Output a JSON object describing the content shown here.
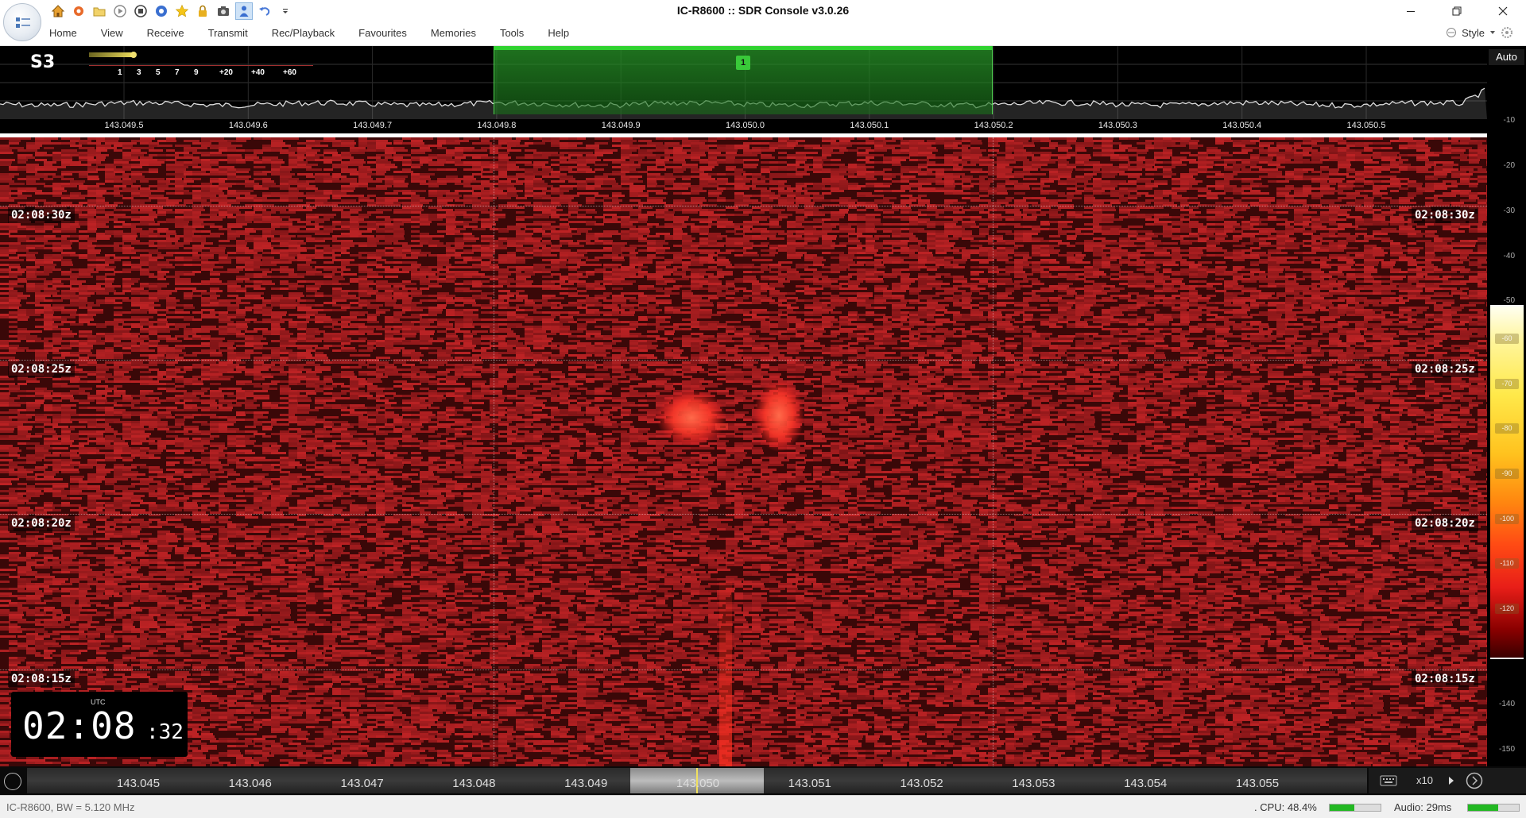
{
  "window": {
    "title": "IC-R8600 :: SDR Console v3.0.26"
  },
  "quick_access": {
    "icons": [
      "home-icon",
      "settings-gear-icon",
      "folder-icon",
      "play-icon",
      "stop-icon",
      "record-icon",
      "star-icon",
      "lock-icon",
      "camera-icon",
      "person-icon",
      "undo-icon",
      "dropdown-icon"
    ]
  },
  "menu": {
    "items": [
      "Home",
      "View",
      "Receive",
      "Transmit",
      "Rec/Playback",
      "Favourites",
      "Memories",
      "Tools",
      "Help"
    ],
    "style_label": "Style"
  },
  "spectrum": {
    "s_meter": "S3",
    "s_scale_ticks": [
      "1",
      "3",
      "5",
      "7",
      "9",
      "+20",
      "+40",
      "+60"
    ],
    "vfo_label": "1",
    "freq_ticks": [
      "143.049.5",
      "143.049.6",
      "143.049.7",
      "143.049.8",
      "143.049.9",
      "143.050.0",
      "143.050.1",
      "143.050.2",
      "143.050.3",
      "143.050.4",
      "143.050.5"
    ]
  },
  "db_scale": {
    "auto_label": "Auto",
    "labels": [
      "-10",
      "-20",
      "-30",
      "-40",
      "-50",
      "-140",
      "-150"
    ],
    "colorbar_labels": [
      "-60",
      "-70",
      "-80",
      "-90",
      "-100",
      "-110",
      "-120"
    ]
  },
  "waterfall": {
    "time_labels": [
      "02:08:30z",
      "02:08:25z",
      "02:08:20z",
      "02:08:15z"
    ],
    "utc_label": "UTC",
    "clock_hm": "02:08",
    "clock_sec": ":32"
  },
  "freq_bar": {
    "ticks": [
      "143.045",
      "143.046",
      "143.047",
      "143.048",
      "143.049",
      "143.050",
      "143.051",
      "143.052",
      "143.053",
      "143.054",
      "143.055"
    ],
    "zoom": "x10"
  },
  "status": {
    "radio": "IC-R8600, BW = 5.120 MHz",
    "cpu": ". CPU: 48.4%",
    "cpu_percent": 48.4,
    "audio": "Audio: 29ms",
    "audio_level_percent": 60
  },
  "colors": {
    "signal_green": "#2fd22f",
    "waterfall_base": "#3a0808",
    "accent_yellow": "#f0e060"
  }
}
